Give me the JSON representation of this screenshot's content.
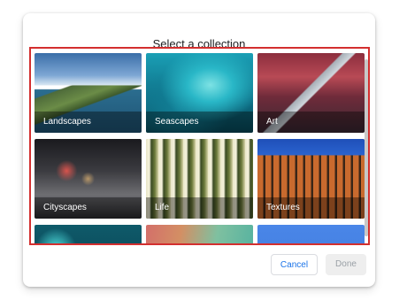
{
  "dialog": {
    "title": "Select a collection",
    "cancel_label": "Cancel",
    "done_label": "Done"
  },
  "collections": [
    {
      "label": "Landscapes"
    },
    {
      "label": "Seascapes"
    },
    {
      "label": "Art"
    },
    {
      "label": "Cityscapes"
    },
    {
      "label": "Life"
    },
    {
      "label": "Textures"
    },
    {
      "label": ""
    },
    {
      "label": ""
    },
    {
      "label": ""
    }
  ],
  "colors": {
    "accent": "#1a73e8",
    "highlight_border": "#d32f2f"
  }
}
